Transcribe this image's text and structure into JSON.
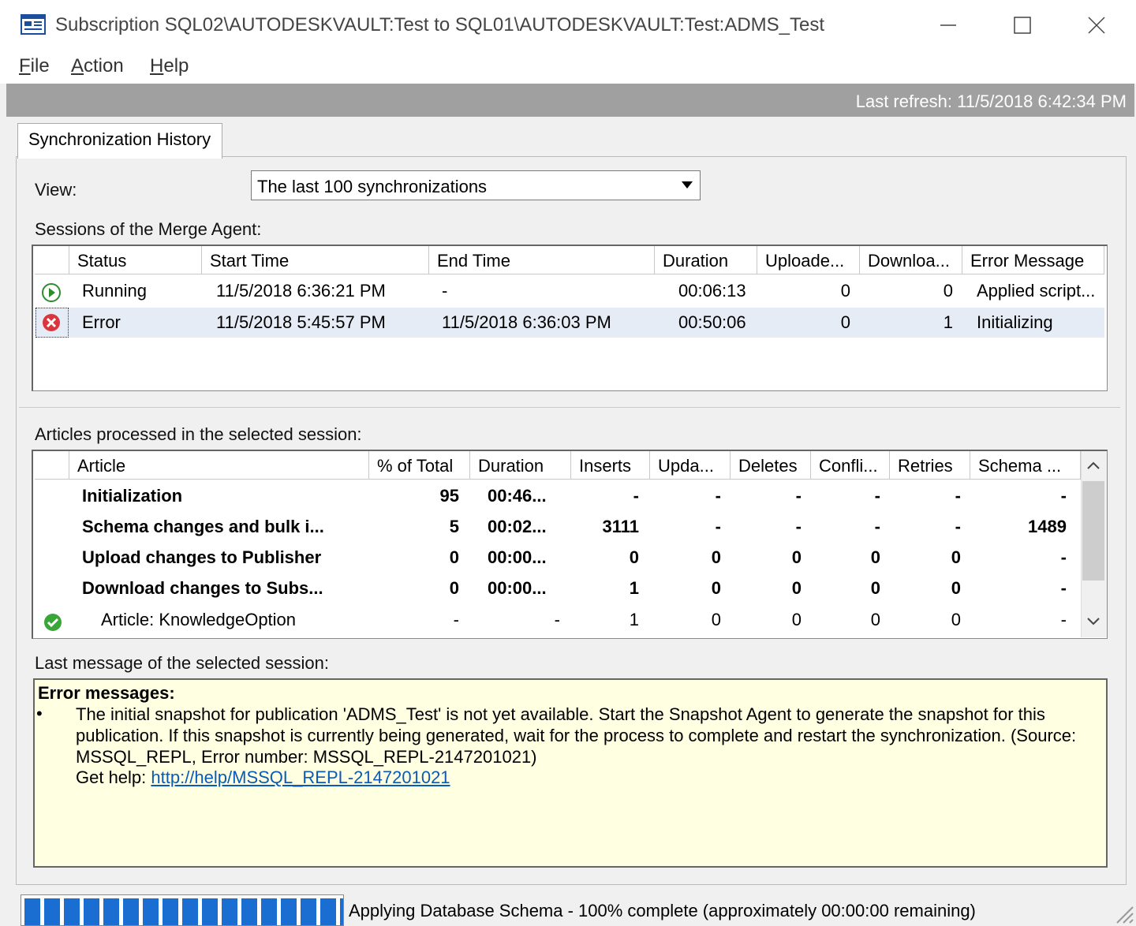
{
  "window": {
    "title": "Subscription SQL02\\AUTODESKVAULT:Test to SQL01\\AUTODESKVAULT:Test:ADMS_Test",
    "icon": "window-app-icon"
  },
  "menu": {
    "file": "File",
    "action": "Action",
    "help": "Help"
  },
  "refresh": {
    "text": "Last refresh: 11/5/2018 6:42:34 PM"
  },
  "tabs": [
    {
      "label": "Synchronization History"
    }
  ],
  "view": {
    "label": "View:",
    "selected": "The last 100 synchronizations"
  },
  "sessions": {
    "label": "Sessions of the Merge Agent:",
    "columns": [
      "Status",
      "Start Time",
      "End Time",
      "Duration",
      "Uploade...",
      "Downloa...",
      "Error Message"
    ],
    "rows": [
      {
        "status": "Running",
        "start": "11/5/2018 6:36:21 PM",
        "end": "-",
        "duration": "00:06:13",
        "uploaded": "0",
        "downloaded": "0",
        "error": "Applied script..."
      },
      {
        "status": "Error",
        "start": "11/5/2018 5:45:57 PM",
        "end": "11/5/2018 6:36:03 PM",
        "duration": "00:50:06",
        "uploaded": "0",
        "downloaded": "1",
        "error": "Initializing"
      }
    ]
  },
  "articles": {
    "label": "Articles processed in the selected session:",
    "columns": [
      "Article",
      "% of Total",
      "Duration",
      "Inserts",
      "Upda...",
      "Deletes",
      "Confli...",
      "Retries",
      "Schema ..."
    ],
    "rows": [
      {
        "article": "Initialization",
        "pct": "95",
        "duration": "00:46...",
        "inserts": "-",
        "updates": "-",
        "deletes": "-",
        "conflicts": "-",
        "retries": "-",
        "schema": "-"
      },
      {
        "article": "Schema changes and bulk i...",
        "pct": "5",
        "duration": "00:02...",
        "inserts": "3111",
        "updates": "-",
        "deletes": "-",
        "conflicts": "-",
        "retries": "-",
        "schema": "1489"
      },
      {
        "article": "Upload changes to Publisher",
        "pct": "0",
        "duration": "00:00...",
        "inserts": "0",
        "updates": "0",
        "deletes": "0",
        "conflicts": "0",
        "retries": "0",
        "schema": "-"
      },
      {
        "article": "Download changes to Subs...",
        "pct": "0",
        "duration": "00:00...",
        "inserts": "1",
        "updates": "0",
        "deletes": "0",
        "conflicts": "0",
        "retries": "0",
        "schema": "-"
      },
      {
        "article": "Article: KnowledgeOption",
        "pct": "-",
        "duration": "-",
        "inserts": "1",
        "updates": "0",
        "deletes": "0",
        "conflicts": "0",
        "retries": "0",
        "schema": "-"
      }
    ]
  },
  "last_message": {
    "label": "Last message of the selected session:",
    "heading": "Error messages:",
    "bullet": "•",
    "body": "The initial snapshot for publication 'ADMS_Test' is not yet available. Start the Snapshot Agent to generate the snapshot for this publication. If this snapshot is currently being generated, wait for the process to complete and restart the synchronization. (Source: MSSQL_REPL, Error number: MSSQL_REPL-2147201021)",
    "help_prefix": "Get help: ",
    "help_link": "http://help/MSSQL_REPL-2147201021"
  },
  "progress": {
    "percent": 100,
    "text": "Applying Database Schema - 100% complete (approximately 00:00:00 remaining)"
  },
  "colors": {
    "accent": "#1b6ed1",
    "refresh_bar": "#a0a0a0",
    "message_bg": "#ffffe1",
    "selected_row": "#e6ecf5"
  }
}
